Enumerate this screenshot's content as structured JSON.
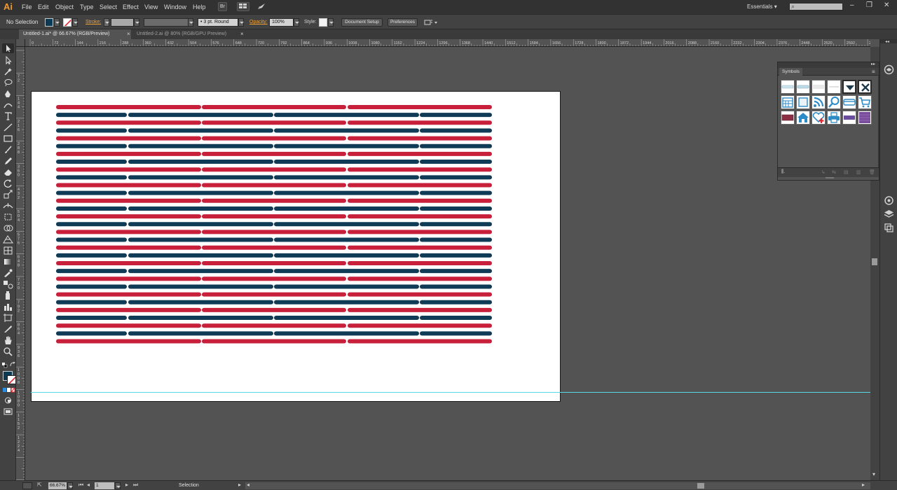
{
  "app": {
    "logo": "Ai"
  },
  "menubar": {
    "items": [
      "File",
      "Edit",
      "Object",
      "Type",
      "Select",
      "Effect",
      "View",
      "Window",
      "Help"
    ],
    "bridge_label": "Br",
    "workspace": "Essentials",
    "workspace_arrow": "▾",
    "search_glyph": "⌕"
  },
  "controlbar": {
    "selection": "No Selection",
    "stroke_label": "Stroke:",
    "brush": "3 pt. Round",
    "opacity_label": "Opacity:",
    "opacity_value": "100%",
    "style_label": "Style:",
    "document_setup": "Document Setup",
    "preferences": "Preferences",
    "fill_color": "#0b3a57"
  },
  "tabs": [
    {
      "label": "Untitled-1.ai* @ 66.67% (RGB/Preview)",
      "active": true
    },
    {
      "label": "Untitled-2.ai @ 80% (RGB/GPU Preview)",
      "active": false
    }
  ],
  "rulers": {
    "h_labels": [
      "0",
      "72",
      "144",
      "216",
      "288",
      "360",
      "432",
      "504",
      "576",
      "648",
      "720",
      "792",
      "864",
      "936",
      "1008",
      "1080",
      "1152",
      "1224",
      "1296",
      "1368",
      "1440",
      "1512",
      "1584",
      "1656",
      "1728",
      "1800",
      "1872",
      "1944",
      "2016",
      "2088",
      "2160",
      "2232",
      "2304",
      "2376",
      "2448",
      "2520",
      "2592",
      "2664"
    ],
    "v_labels": [
      "7 2",
      "1 4 4",
      "2 1 6",
      "2 8 8",
      "3 6 0",
      "4 3 2",
      "5 0 4",
      "5 7 6",
      "6 4 8",
      "7 2 0",
      "7 9 2",
      "8 6 4",
      "9 3 6",
      "1 0 0 8",
      "1 0 8 0",
      "1 1 5 2",
      "1 2 2 4"
    ]
  },
  "artwork": {
    "rows": 31,
    "red": "#c8203b",
    "navy": "#0f3b57"
  },
  "symbols": {
    "title": "Symbols",
    "items": [
      "bar-light-1",
      "bar-light-2",
      "bar-light-3",
      "bar-light-4",
      "dropdown-arrow",
      "close-x",
      "calendar",
      "frame",
      "rss",
      "magnifier",
      "card",
      "cart",
      "bar-maroon",
      "home",
      "heart-plus",
      "printer",
      "bar-purple",
      "grid-purple"
    ]
  },
  "statusbar": {
    "zoom": "66.67%",
    "page": "1",
    "status": "Selection"
  }
}
